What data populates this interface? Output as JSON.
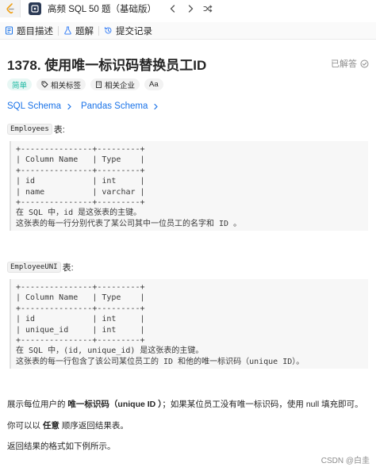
{
  "topbar": {
    "title": "高频 SQL 50 题（基础版）",
    "prev_icon": "chevron-left-icon",
    "next_icon": "chevron-right-icon",
    "shuffle_icon": "shuffle-icon"
  },
  "tabs": [
    {
      "label": "题目描述",
      "icon": "document-icon"
    },
    {
      "label": "题解",
      "icon": "flask-icon"
    },
    {
      "label": "提交记录",
      "icon": "history-icon"
    }
  ],
  "problem": {
    "title": "1378. 使用唯一标识码替换员工ID",
    "solved_label": "已解答",
    "tags": [
      "简单",
      "相关标签",
      "相关企业",
      "Aa"
    ],
    "links": [
      "SQL Schema",
      "Pandas Schema"
    ]
  },
  "table1": {
    "name": "Employees",
    "suffix": "表:",
    "schema": "+---------------+---------+\n| Column Name   | Type    |\n+---------------+---------+\n| id            | int     |\n| name          | varchar |\n+---------------+---------+\n在 SQL 中，id 是这张表的主键。\n这张表的每一行分别代表了某公司其中一位员工的名字和 ID 。"
  },
  "table2": {
    "name": "EmployeeUNI",
    "suffix": "表:",
    "schema": "+---------------+---------+\n| Column Name   | Type    |\n+---------------+---------+\n| id            | int     |\n| unique_id     | int     |\n+---------------+---------+\n在 SQL 中，(id, unique_id) 是这张表的主键。\n这张表的每一行包含了该公司某位员工的 ID 和他的唯一标识码（unique ID）。"
  },
  "description": {
    "p1_a": "展示每位用户的 ",
    "p1_b": "唯一标识码（unique ID ）",
    "p1_c": "；如果某位员工没有唯一标识码，使用 null 填充即可。",
    "p2_a": "你可以以 ",
    "p2_b": "任意",
    "p2_c": " 顺序返回结果表。",
    "p3": "返回结果的格式如下例所示。"
  },
  "watermark": "CSDN @白圭"
}
